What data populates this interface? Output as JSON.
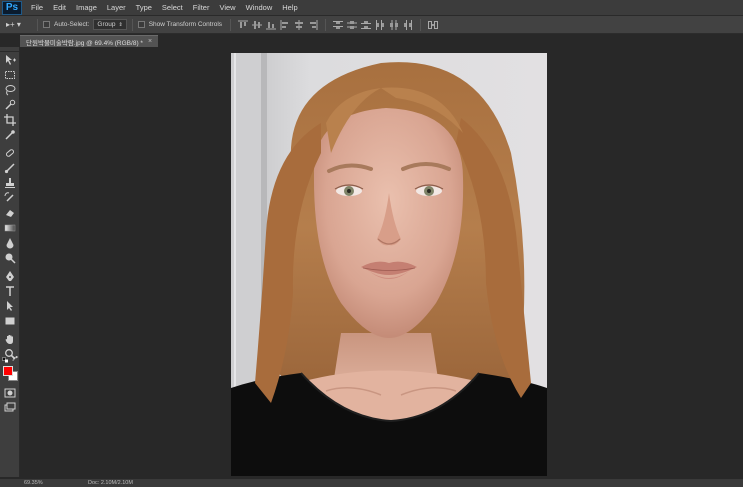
{
  "app": {
    "logo": "Ps"
  },
  "menu": [
    "File",
    "Edit",
    "Image",
    "Layer",
    "Type",
    "Select",
    "Filter",
    "View",
    "Window",
    "Help"
  ],
  "options": {
    "tool_glyph": "▸+ ▾",
    "auto_select_label": "Auto-Select:",
    "auto_select_value": "Group",
    "show_transform_label": "Show Transform Controls"
  },
  "document": {
    "tab_title": "단원박물미술박람.jpg @ 69.4% (RGB/8) *",
    "close_glyph": "×"
  },
  "colors": {
    "foreground": "#ff0000",
    "background": "#ffffff"
  },
  "status": {
    "zoom": "69.35%",
    "doc_info": "Doc: 2.10M/2.10M"
  }
}
